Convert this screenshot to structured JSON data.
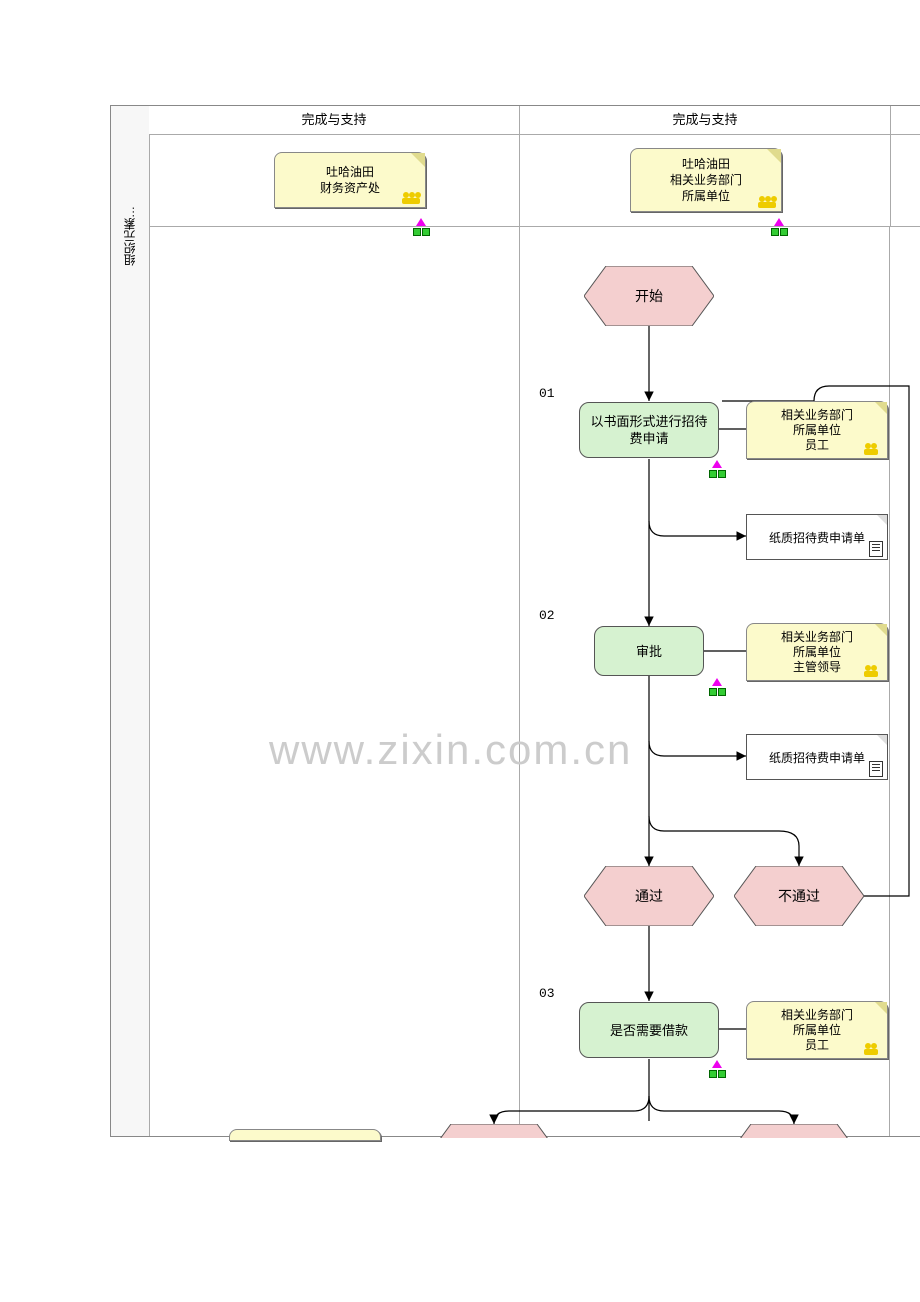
{
  "sidebar": {
    "label": "组织元素…"
  },
  "headers": {
    "col1": "完成与支持",
    "col2": "完成与支持"
  },
  "orgs": {
    "left": {
      "line1": "吐哈油田",
      "line2": "财务资产处"
    },
    "right": {
      "line1": "吐哈油田",
      "line2": "相关业务部门",
      "line3": "所属单位"
    }
  },
  "watermark": "www.zixin.com.cn",
  "nodes": {
    "start": "开始",
    "step01_num": "01",
    "step01": "以书面形式进行招待费申请",
    "role01": {
      "l1": "相关业务部门",
      "l2": "所属单位",
      "l3": "员工"
    },
    "doc01": "纸质招待费申请单",
    "step02_num": "02",
    "step02": "审批",
    "role02": {
      "l1": "相关业务部门",
      "l2": "所属单位",
      "l3": "主管领导"
    },
    "doc02": "纸质招待费申请单",
    "pass": "通过",
    "fail": "不通过",
    "step03_num": "03",
    "step03": "是否需要借款",
    "role03": {
      "l1": "相关业务部门",
      "l2": "所属单位",
      "l3": "员工"
    }
  }
}
